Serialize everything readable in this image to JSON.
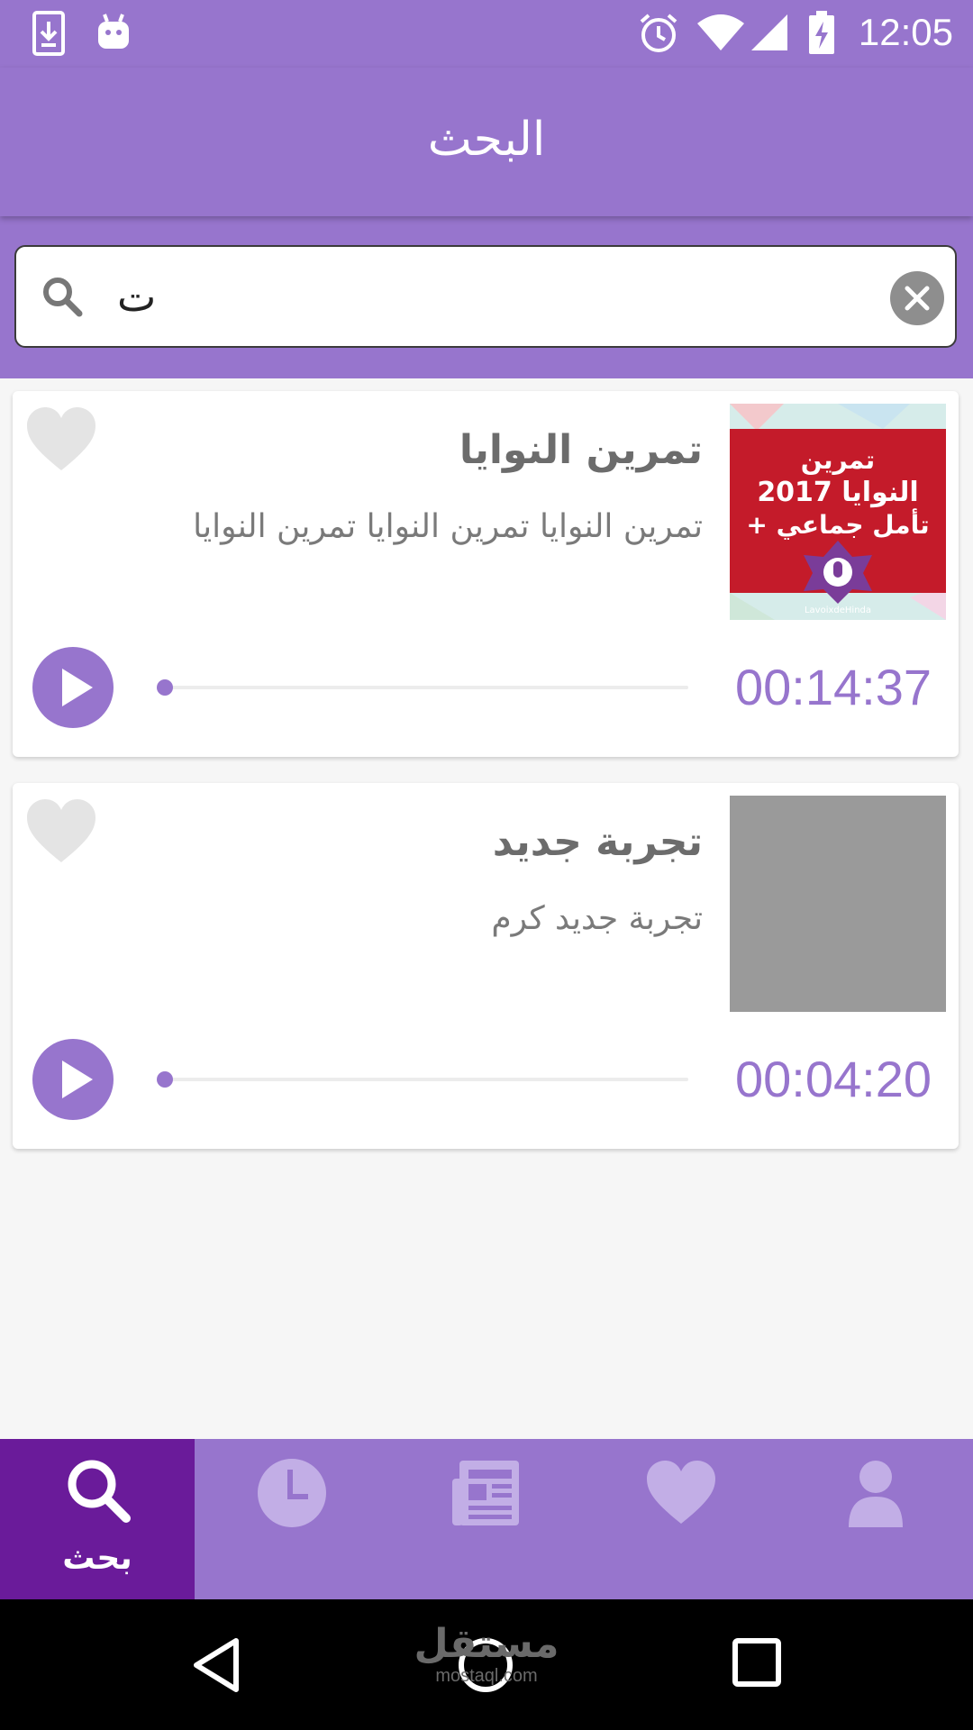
{
  "status_bar": {
    "time": "12:05",
    "icons": [
      "download-icon",
      "android-icon",
      "alarm-icon",
      "wifi-icon",
      "signal-icon",
      "battery-charging-icon"
    ]
  },
  "app_bar": {
    "title": "البحث"
  },
  "search": {
    "query": "ت"
  },
  "results": [
    {
      "title": "تمرين النوايا",
      "description": "تمرين النوايا تمرين النوايا تمرين النوايا",
      "duration": "00:14:37",
      "thumbnail": {
        "line1": "تمرين",
        "line2": "النوايا 2017",
        "line3": "+ تأمل جماعي",
        "brand": "LavoixdeHinda"
      },
      "progress": 0
    },
    {
      "title": "تجربة جديد",
      "description": "تجربة جديد كرم",
      "duration": "00:04:20",
      "thumbnail_color": "#9a9a9a",
      "progress": 0
    }
  ],
  "bottom_nav": {
    "items": [
      {
        "icon": "search-icon",
        "label": "بحث",
        "active": true
      },
      {
        "icon": "clock-icon",
        "label": "",
        "active": false
      },
      {
        "icon": "newspaper-icon",
        "label": "",
        "active": false
      },
      {
        "icon": "heart-icon",
        "label": "",
        "active": false
      },
      {
        "icon": "profile-icon",
        "label": "",
        "active": false
      }
    ]
  },
  "watermark": {
    "text": "مستقل",
    "subtext": "mostaql.com"
  },
  "colors": {
    "primary": "#9775cd",
    "active_tab": "#6a1b9a",
    "duration_text": "#9775cd",
    "background": "#f6f6f6"
  }
}
